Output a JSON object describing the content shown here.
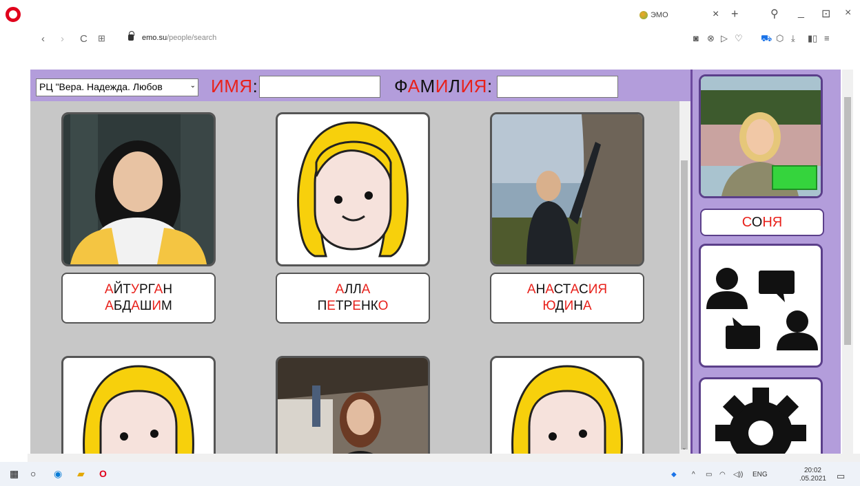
{
  "browser": {
    "tab_title": "ЭМО",
    "url_domain": "emo.su",
    "url_path": "/people/search",
    "tab_close": "×",
    "new_tab": "+",
    "nav": {
      "back": "‹",
      "forward": "›",
      "reload": "C",
      "grid": "⊞"
    },
    "window": {
      "search": "⚲",
      "minimize": "_",
      "maximize": "⊡",
      "close": "×"
    }
  },
  "filter": {
    "center_select": "РЦ \"Вера. Надежда. Любов",
    "name_label_parts": [
      "И",
      "М",
      "Я",
      ":"
    ],
    "surname_label_parts": [
      "Ф",
      "А",
      "М",
      "И",
      "Л",
      "И",
      "Я",
      ":"
    ]
  },
  "people": [
    {
      "line1": [
        [
          "А",
          "r"
        ],
        [
          "Й",
          "b"
        ],
        [
          "Т",
          "b"
        ],
        [
          "У",
          "r"
        ],
        [
          "Р",
          "b"
        ],
        [
          "Г",
          "b"
        ],
        [
          "А",
          "r"
        ],
        [
          "Н",
          "b"
        ]
      ],
      "line2": [
        [
          "А",
          "r"
        ],
        [
          "Б",
          "b"
        ],
        [
          "Д",
          "b"
        ],
        [
          "А",
          "r"
        ],
        [
          "Ш",
          "b"
        ],
        [
          "И",
          "r"
        ],
        [
          "М",
          "b"
        ]
      ],
      "avatar": "photo-girl-asian"
    },
    {
      "line1": [
        [
          "А",
          "r"
        ],
        [
          "Л",
          "b"
        ],
        [
          "Л",
          "b"
        ],
        [
          "А",
          "r"
        ]
      ],
      "line2": [
        [
          "П",
          "b"
        ],
        [
          "Е",
          "r"
        ],
        [
          "Т",
          "b"
        ],
        [
          "Р",
          "b"
        ],
        [
          "Е",
          "r"
        ],
        [
          "Н",
          "b"
        ],
        [
          "К",
          "b"
        ],
        [
          "О",
          "r"
        ]
      ],
      "avatar": "pictogram-girl"
    },
    {
      "line1": [
        [
          "А",
          "r"
        ],
        [
          "Н",
          "b"
        ],
        [
          "А",
          "r"
        ],
        [
          "С",
          "b"
        ],
        [
          "Т",
          "b"
        ],
        [
          "А",
          "r"
        ],
        [
          "С",
          "b"
        ],
        [
          "И",
          "r"
        ],
        [
          "Я",
          "r"
        ]
      ],
      "line2": [
        [
          "Ю",
          "r"
        ],
        [
          "Д",
          "b"
        ],
        [
          "И",
          "r"
        ],
        [
          "Н",
          "b"
        ],
        [
          "А",
          "r"
        ]
      ],
      "avatar": "photo-climber"
    },
    {
      "avatar": "pictogram-girl"
    },
    {
      "avatar": "photo-girl-street"
    },
    {
      "avatar": "pictogram-girl"
    }
  ],
  "profile": {
    "name_parts": [
      [
        "С",
        "r"
      ],
      [
        "О",
        "b"
      ],
      [
        "Н",
        "r"
      ],
      [
        "Я",
        "r"
      ]
    ]
  },
  "sidebar_icons": [
    "people-chat-icon",
    "gear-icon"
  ],
  "taskbar": {
    "lang": "ENG",
    "time": "20:02",
    "date": ".05.2021"
  },
  "colors": {
    "accent_purple": "#b39ddb",
    "red_vowel": "#e8211b",
    "grid_bg": "#c7c7c7"
  }
}
